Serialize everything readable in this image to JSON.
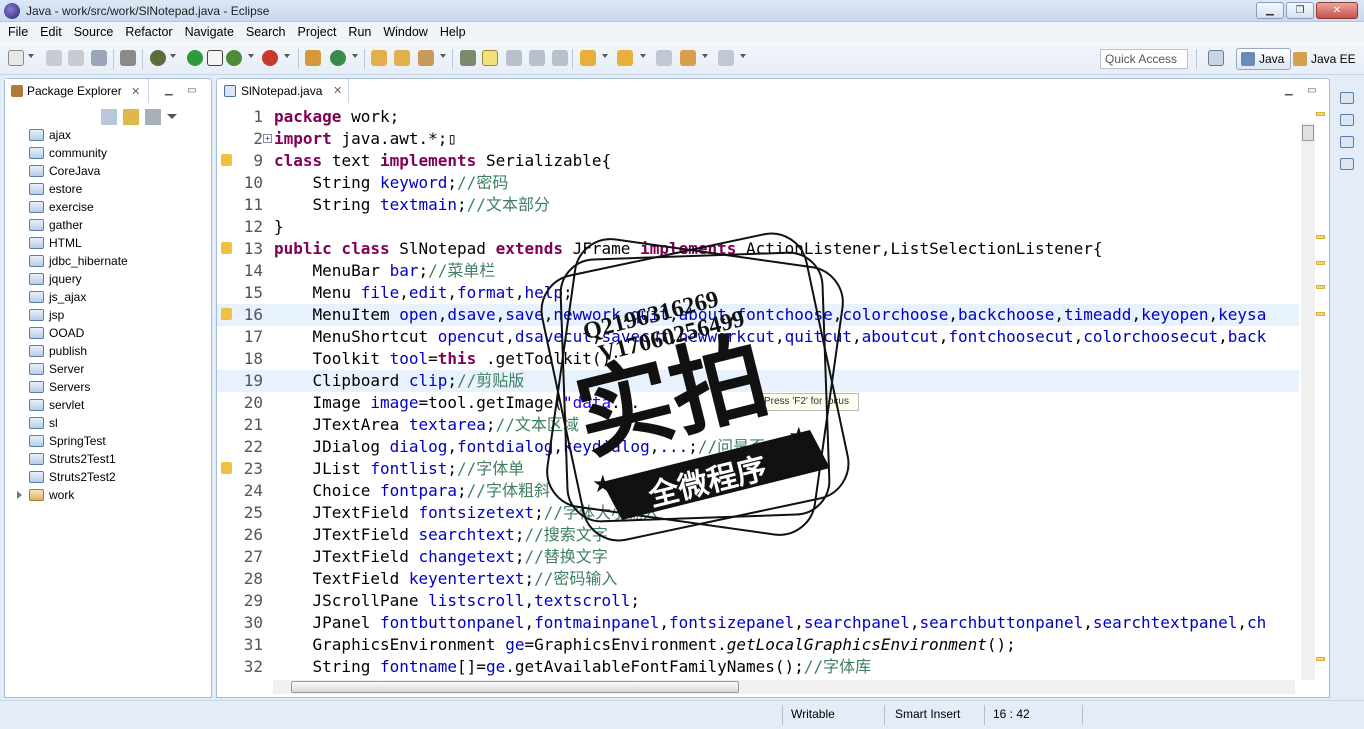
{
  "window": {
    "title": "Java - work/src/work/SlNotepad.java - Eclipse",
    "controls": {
      "minimize": "▁",
      "maximize": "❐",
      "close": "✕"
    }
  },
  "menubar": {
    "items": [
      "File",
      "Edit",
      "Source",
      "Refactor",
      "Navigate",
      "Search",
      "Project",
      "Run",
      "Window",
      "Help"
    ]
  },
  "toolbar": {
    "quick_access_placeholder": "Quick Access",
    "perspectives": [
      {
        "label": "Java",
        "active": true,
        "icon": "java-perspective-icon"
      },
      {
        "label": "Java EE",
        "active": false,
        "icon": "javaee-perspective-icon"
      }
    ]
  },
  "package_explorer": {
    "tab_label": "Package Explorer",
    "tab_close": "✕",
    "projects": [
      "ajax",
      "community",
      "CoreJava",
      "estore",
      "exercise",
      "gather",
      "HTML",
      "jdbc_hibernate",
      "jquery",
      "js_ajax",
      "jsp",
      "OOAD",
      "publish",
      "Server",
      "Servers",
      "servlet",
      "sl",
      "SpringTest",
      "Struts2Test1",
      "Struts2Test2",
      "work"
    ]
  },
  "editor": {
    "tab_label": "SlNotepad.java",
    "tab_close": "✕",
    "lines": [
      {
        "n": "1",
        "tokens": [
          [
            "kw",
            "package"
          ],
          [
            "",
            "work;"
          ]
        ]
      },
      {
        "n": "2",
        "fold": true,
        "tokens": [
          [
            "kw",
            "import"
          ],
          [
            "",
            "java.awt.*;"
          ],
          [
            "",
            "▯"
          ]
        ]
      },
      {
        "n": "9",
        "marker": true,
        "tokens": [
          [
            "kw",
            "class"
          ],
          [
            "",
            "text "
          ],
          [
            "kw",
            "implements"
          ],
          [
            "",
            "Serializable{"
          ]
        ]
      },
      {
        "n": "10",
        "tokens": [
          [
            "",
            "    String "
          ],
          [
            "fd",
            "keyword"
          ],
          [
            "",
            ";"
          ],
          [
            "cm",
            "//密码"
          ]
        ]
      },
      {
        "n": "11",
        "tokens": [
          [
            "",
            "    String "
          ],
          [
            "fd",
            "textmain"
          ],
          [
            "",
            ";"
          ],
          [
            "cm",
            "//文本部分"
          ]
        ]
      },
      {
        "n": "12",
        "tokens": [
          [
            "",
            "}"
          ]
        ]
      },
      {
        "n": "13",
        "marker": true,
        "tokens": [
          [
            "kw",
            "public class"
          ],
          [
            "",
            "SlNotepad "
          ],
          [
            "kw",
            "extends"
          ],
          [
            "",
            "JFrame "
          ],
          [
            "kw",
            "implements"
          ],
          [
            "",
            "ActionListener,ListSelectionListener{"
          ]
        ]
      },
      {
        "n": "14",
        "tokens": [
          [
            "",
            "    MenuBar "
          ],
          [
            "fd",
            "bar"
          ],
          [
            "",
            ";"
          ],
          [
            "cm",
            "//菜单栏"
          ]
        ]
      },
      {
        "n": "15",
        "tokens": [
          [
            "",
            "    Menu "
          ],
          [
            "fd",
            "file"
          ],
          [
            "",
            ","
          ],
          [
            "fd",
            "edit"
          ],
          [
            "",
            ","
          ],
          [
            "fd",
            "format"
          ],
          [
            "",
            ","
          ],
          [
            "fd",
            "help"
          ],
          [
            "",
            ";"
          ]
        ]
      },
      {
        "n": "16",
        "highlight": true,
        "marker": true,
        "tokens": [
          [
            "",
            "    MenuItem "
          ],
          [
            "fd",
            "open"
          ],
          [
            "",
            ","
          ],
          [
            "fd",
            "dsave"
          ],
          [
            "",
            ","
          ],
          [
            "fd",
            "save"
          ],
          [
            "",
            ","
          ],
          [
            "fd",
            "newwork"
          ],
          [
            "",
            ","
          ],
          [
            "fd",
            "quit"
          ],
          [
            "",
            ","
          ],
          [
            "fd",
            "about"
          ],
          [
            "",
            ","
          ],
          [
            "fd",
            "fontchoose"
          ],
          [
            "",
            ","
          ],
          [
            "fd",
            "colorchoose"
          ],
          [
            "",
            ","
          ],
          [
            "fd",
            "backchoose"
          ],
          [
            "",
            ","
          ],
          [
            "fd",
            "timeadd"
          ],
          [
            "",
            ","
          ],
          [
            "fd",
            "keyopen"
          ],
          [
            "",
            ","
          ],
          [
            "fd",
            "keysa"
          ]
        ]
      },
      {
        "n": "17",
        "tokens": [
          [
            "",
            "    MenuShortcut "
          ],
          [
            "fd",
            "opencut"
          ],
          [
            "",
            ","
          ],
          [
            "fd",
            "dsavecut"
          ],
          [
            "",
            ","
          ],
          [
            "fd",
            "savecut"
          ],
          [
            "",
            ","
          ],
          [
            "fd",
            "newworkcut"
          ],
          [
            "",
            ","
          ],
          [
            "fd",
            "quitcut"
          ],
          [
            "",
            ","
          ],
          [
            "fd",
            "aboutcut"
          ],
          [
            "",
            ","
          ],
          [
            "fd",
            "fontchoosecut"
          ],
          [
            "",
            ","
          ],
          [
            "fd",
            "colorchoosecut"
          ],
          [
            "",
            ","
          ],
          [
            "fd",
            "back"
          ]
        ]
      },
      {
        "n": "18",
        "tokens": [
          [
            "",
            "    Toolkit "
          ],
          [
            "fd",
            "tool"
          ],
          [
            "",
            "="
          ],
          [
            "kw",
            "this"
          ],
          [
            "",
            ".getToolkit();"
          ]
        ]
      },
      {
        "n": "19",
        "highlight": true,
        "tokens": [
          [
            "",
            "    Clipboard "
          ],
          [
            "fd",
            "clip"
          ],
          [
            "",
            ";"
          ],
          [
            "cm",
            "//剪贴版"
          ]
        ]
      },
      {
        "n": "20",
        "tokens": [
          [
            "",
            "    Image "
          ],
          [
            "fd",
            "image"
          ],
          [
            "",
            "=tool.getImage("
          ],
          [
            "st",
            "\"data"
          ],
          [
            "",
            "..."
          ]
        ]
      },
      {
        "n": "21",
        "tokens": [
          [
            "",
            "    JTextArea "
          ],
          [
            "fd",
            "textarea"
          ],
          [
            "",
            ";"
          ],
          [
            "cm",
            "//文本区域"
          ]
        ]
      },
      {
        "n": "22",
        "tokens": [
          [
            "",
            "    JDialog "
          ],
          [
            "fd",
            "dialog"
          ],
          [
            "",
            ","
          ],
          [
            "fd",
            "fontdialog"
          ],
          [
            "",
            ","
          ],
          [
            "fd",
            "keydialog"
          ],
          [
            "",
            ","
          ],
          [
            "fd",
            "..."
          ],
          [
            "",
            ";"
          ],
          [
            "cm",
            "//问是否"
          ]
        ]
      },
      {
        "n": "23",
        "marker": true,
        "tokens": [
          [
            "",
            "    JList "
          ],
          [
            "fd",
            "fontlist"
          ],
          [
            "",
            ";"
          ],
          [
            "cm",
            "//字体单"
          ]
        ]
      },
      {
        "n": "24",
        "tokens": [
          [
            "",
            "    Choice "
          ],
          [
            "fd",
            "fontpara"
          ],
          [
            "",
            ";"
          ],
          [
            "cm",
            "//字体粗斜"
          ]
        ]
      },
      {
        "n": "25",
        "tokens": [
          [
            "",
            "    JTextField "
          ],
          [
            "fd",
            "fontsizetext"
          ],
          [
            "",
            ";"
          ],
          [
            "cm",
            "//字体大小输入"
          ]
        ]
      },
      {
        "n": "26",
        "tokens": [
          [
            "",
            "    JTextField "
          ],
          [
            "fd",
            "searchtext"
          ],
          [
            "",
            ";"
          ],
          [
            "cm",
            "//搜索文字"
          ]
        ]
      },
      {
        "n": "27",
        "tokens": [
          [
            "",
            "    JTextField "
          ],
          [
            "fd",
            "changetext"
          ],
          [
            "",
            ";"
          ],
          [
            "cm",
            "//替换文字"
          ]
        ]
      },
      {
        "n": "28",
        "tokens": [
          [
            "",
            "    TextField "
          ],
          [
            "fd",
            "keyentertext"
          ],
          [
            "",
            ";"
          ],
          [
            "cm",
            "//密码输入"
          ]
        ]
      },
      {
        "n": "29",
        "tokens": [
          [
            "",
            "    JScrollPane "
          ],
          [
            "fd",
            "listscroll"
          ],
          [
            "",
            ","
          ],
          [
            "fd",
            "textscroll"
          ],
          [
            "",
            ";"
          ]
        ]
      },
      {
        "n": "30",
        "tokens": [
          [
            "",
            "    JPanel "
          ],
          [
            "fd",
            "fontbuttonpanel"
          ],
          [
            "",
            ","
          ],
          [
            "fd",
            "fontmainpanel"
          ],
          [
            "",
            ","
          ],
          [
            "fd",
            "fontsizepanel"
          ],
          [
            "",
            ","
          ],
          [
            "fd",
            "searchpanel"
          ],
          [
            "",
            ","
          ],
          [
            "fd",
            "searchbuttonpanel"
          ],
          [
            "",
            ","
          ],
          [
            "fd",
            "searchtextpanel"
          ],
          [
            "",
            ","
          ],
          [
            "fd",
            "ch"
          ]
        ]
      },
      {
        "n": "31",
        "tokens": [
          [
            "",
            "    GraphicsEnvironment "
          ],
          [
            "fd",
            "ge"
          ],
          [
            "",
            "=GraphicsEnvironment."
          ],
          [
            "it",
            "getLocalGraphicsEnvironment"
          ],
          [
            "",
            "();"
          ]
        ]
      },
      {
        "n": "32",
        "tokens": [
          [
            "",
            "    String "
          ],
          [
            "fd",
            "fontname"
          ],
          [
            "",
            "[]="
          ],
          [
            "fd",
            "ge"
          ],
          [
            "",
            ".getAvailableFontFamilyNames();"
          ],
          [
            "cm",
            "//字体库"
          ]
        ]
      }
    ],
    "tooltip_text": "Press 'F2' for focus"
  },
  "statusbar": {
    "writable": "Writable",
    "insert_mode": "Smart Insert",
    "position": "16 : 42"
  },
  "watermark": {
    "line1": "Q2196316269",
    "line2": "V17060256499",
    "main": "实拍",
    "banner": "全微程序"
  }
}
